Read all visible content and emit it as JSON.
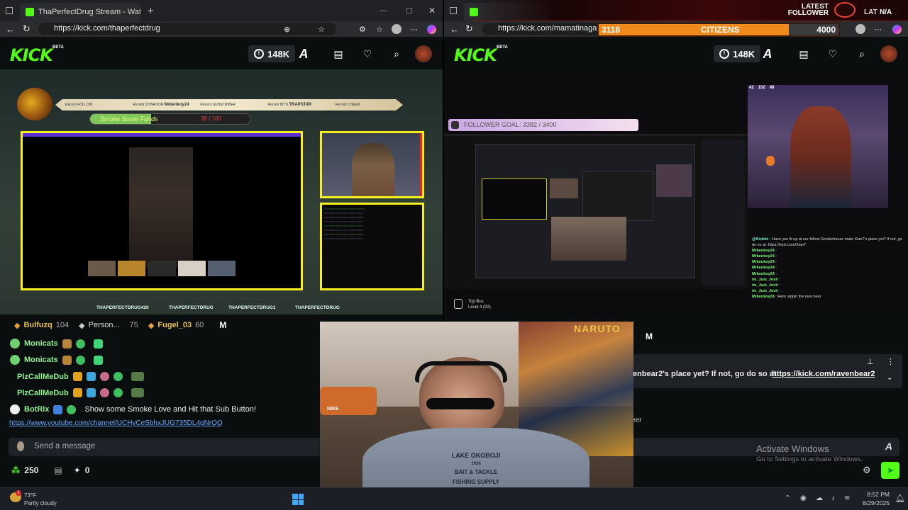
{
  "left_window": {
    "tab_title": "ThaPerfectDrug Stream - Watch L",
    "url": "https://kick.com/thaperfectdrug",
    "kick_logo": "KICK",
    "beta": "BETA",
    "viewers": "148K",
    "overlay": {
      "alert_cells": [
        {
          "label": "Recent FOLLOW",
          "value": ""
        },
        {
          "label": "Recent DONATION",
          "value": "Mrkenkoy24"
        },
        {
          "label": "Recent SUBSCRIBER",
          "value": ""
        },
        {
          "label": "Recent BITS",
          "value": "TRAPST4R"
        },
        {
          "label": "Recent CHEER",
          "value": ""
        }
      ],
      "goal_label": "Smoke Some Funds",
      "goal_progress": "38 / 100",
      "socials": [
        "THAPERFECTDRUG420",
        "THAPERFECTDRUG",
        "THAPERFECTDRUG1",
        "THAPERFECTDRUG"
      ]
    },
    "leaderboard": [
      {
        "name": "Bulfuzq",
        "count": "104"
      },
      {
        "name": "Person...",
        "count": "75"
      },
      {
        "name": "Fugel_03",
        "count": "60"
      }
    ],
    "leaderboard_extra": "M",
    "chat": [
      {
        "user": "Monicats",
        "message": ""
      },
      {
        "user": "Monicats",
        "message": ""
      },
      {
        "user": "PlzCallMeDub",
        "message": ""
      },
      {
        "user": "PlzCallMeDub",
        "message": ""
      },
      {
        "user": "BotRix",
        "message": "Show some Smoke Love and Hit that Sub Button!"
      }
    ],
    "chat_link": "https://www.youtube.com/channel/UCHyCeSbhxJUG735DL4gNrQQ",
    "send_placeholder": "Send a message",
    "points": "250",
    "counter": "0"
  },
  "right_window": {
    "url": "https://kick.com/mamatinagaming",
    "kick_logo": "KICK",
    "beta": "BETA",
    "viewers": "148K",
    "overlay_bar": {
      "left": "3118",
      "center": "CITIZENS",
      "right": "4000"
    },
    "latest_follower": {
      "title": "LATEST FOLLOWER",
      "value": "N/A",
      "prefix": "LAT"
    },
    "follower_goal": "FOLLOWER GOAL: 3382 / 3400",
    "cam_stats": {
      "a": "42",
      "b": "102",
      "c": "48"
    },
    "top_bus": {
      "title": "Top Bus",
      "level": "Level 4",
      "count": "(92)"
    },
    "side_chat": [
      {
        "user": "@Kickini",
        "msg": "Have you lit up at our fellow Smokehouse mate Xian7's place yet? If not, go do so at: https://kick.com/Xian7"
      },
      {
        "user": "Mrkenkoy24",
        "msg": ""
      },
      {
        "user": "Mrkenkoy24",
        "msg": ""
      },
      {
        "user": "Mrkenkoy24",
        "msg": ""
      },
      {
        "user": "Mrkenkoy24",
        "msg": ""
      },
      {
        "user": "Mrkenkoy24",
        "msg": ""
      },
      {
        "user": "im_Just_Josh",
        "msg": ""
      },
      {
        "user": "im_Just_Josh",
        "msg": ""
      },
      {
        "user": "im_Just_Josh",
        "msg": ""
      },
      {
        "user": "Mrkenkoy24",
        "msg": "Here sippin the new beer"
      }
    ],
    "pinned_text": "enbear2's place yet? If not, go do so at:",
    "pinned_link": "https://kick.com/ravenbear2",
    "partial_text": "eer",
    "leaderboard_extra": "M",
    "activate_title": "Activate Windows",
    "activate_sub": "Go to Settings to activate Windows."
  },
  "facecam": {
    "hoodie_text": "LAKE OKOBOJI",
    "hoodie_text2": "BAIT & TACKLE",
    "hoodie_text3": "FISHING SUPPLY",
    "hoodie_year": "1926",
    "poster_text": "NARUTO",
    "shoe_brand": "NIKE"
  },
  "taskbar": {
    "weather_temp": "73°F",
    "weather_desc": "Partly cloudy",
    "time": "8:52 PM",
    "date": "8/29/2025"
  },
  "colors": {
    "kick_green": "#53fc18",
    "overlay_orange": "#f08a1c",
    "goal_pink": "#e8cfe8"
  }
}
